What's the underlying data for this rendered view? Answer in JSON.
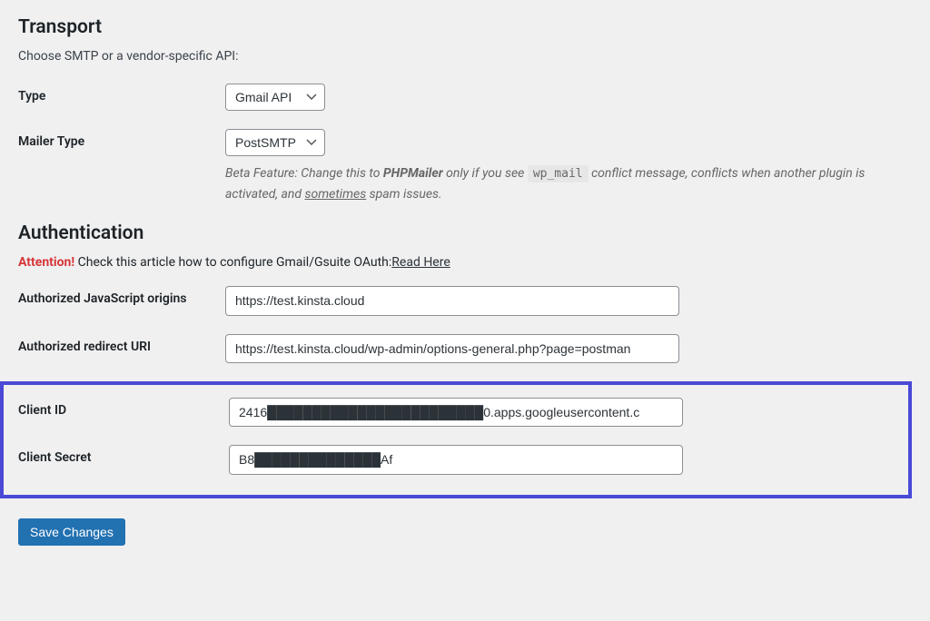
{
  "transport": {
    "heading": "Transport",
    "subtitle": "Choose SMTP or a vendor-specific API:",
    "type_label": "Type",
    "type_value": "Gmail API",
    "mailer_label": "Mailer Type",
    "mailer_value": "PostSMTP",
    "beta_prefix": "Beta Feature: Change this to ",
    "beta_bold": "PHPMailer",
    "beta_mid1": " only if you see ",
    "beta_code": "wp_mail",
    "beta_mid2": " conflict message, conflicts when another plugin is activated, and ",
    "beta_underline": "sometimes",
    "beta_end": " spam issues."
  },
  "auth": {
    "heading": "Authentication",
    "attention_label": "Attention!",
    "attention_text": " Check this article how to configure Gmail/Gsuite OAuth:",
    "attention_link": "Read Here",
    "origins_label": "Authorized JavaScript origins",
    "origins_value": "https://test.kinsta.cloud",
    "redirect_label": "Authorized redirect URI",
    "redirect_value": "https://test.kinsta.cloud/wp-admin/options-general.php?page=postman",
    "client_id_label": "Client ID",
    "client_id_value": "2416████████████████████████0.apps.googleusercontent.c",
    "client_secret_label": "Client Secret",
    "client_secret_value": "B8██████████████Af"
  },
  "actions": {
    "save": "Save Changes"
  }
}
